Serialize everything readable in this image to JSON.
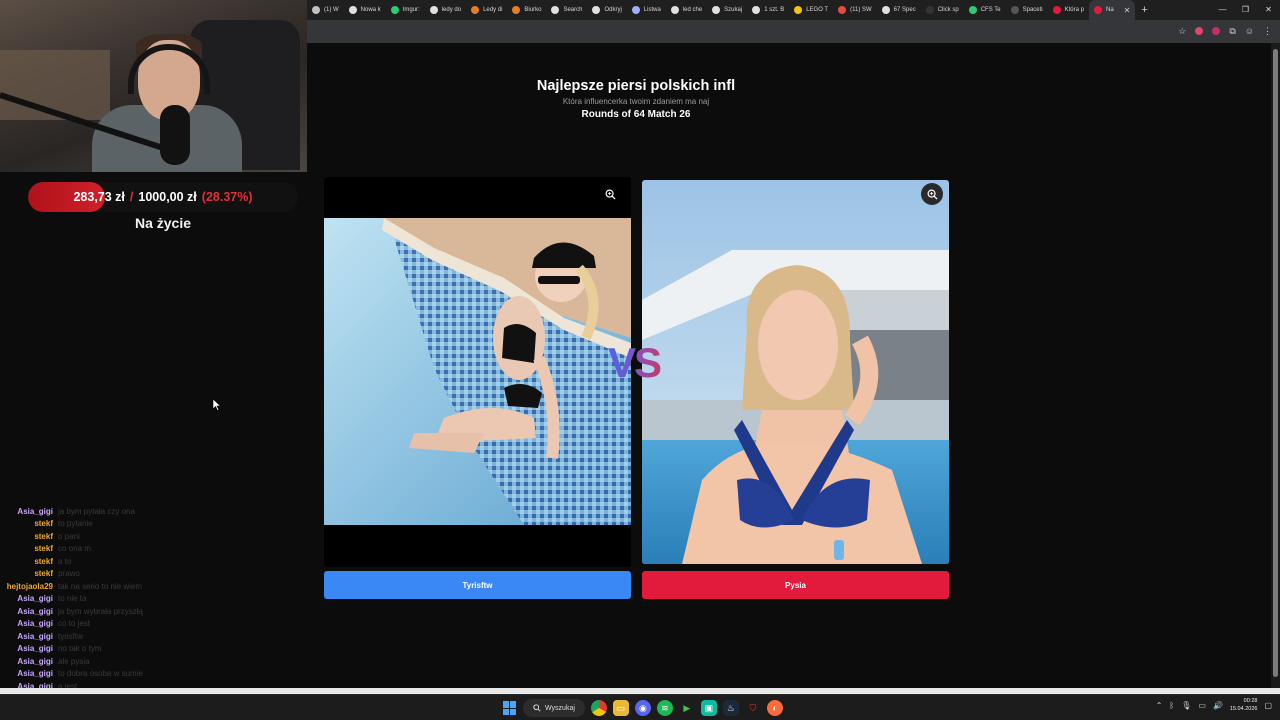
{
  "browser": {
    "tabs": [
      {
        "label": "(1) W",
        "color": "#c0c0c0"
      },
      {
        "label": "Nowa k",
        "color": "#e0e0e0"
      },
      {
        "label": "Imgur:",
        "color": "#2ecc71"
      },
      {
        "label": "ledy do",
        "color": "#e0e0e0"
      },
      {
        "label": "Ledy di",
        "color": "#e67e22"
      },
      {
        "label": "Biurko",
        "color": "#e67e22"
      },
      {
        "label": "Search",
        "color": "#e0e0e0"
      },
      {
        "label": "Odkryj",
        "color": "#e0e0e0"
      },
      {
        "label": "Listwa",
        "color": "#9bb0ff"
      },
      {
        "label": "led che",
        "color": "#e0e0e0"
      },
      {
        "label": "Szukaj",
        "color": "#e0e0e0"
      },
      {
        "label": "1 szt. B",
        "color": "#e0e0e0"
      },
      {
        "label": "LEGO T",
        "color": "#f1c40f"
      },
      {
        "label": "(11) SW",
        "color": "#e74c3c"
      },
      {
        "label": "67 Spec",
        "color": "#e0e0e0"
      },
      {
        "label": "Click sp",
        "color": "#333333"
      },
      {
        "label": "CFS Te",
        "color": "#2ecc71"
      },
      {
        "label": "Spaceti",
        "color": "#555555"
      },
      {
        "label": "Która p",
        "color": "#e21b3c"
      },
      {
        "label": "Na",
        "color": "#e21b3c",
        "active": true
      }
    ],
    "new_tab": "+",
    "window_controls": [
      "—",
      "❐",
      "✕"
    ]
  },
  "stream": {
    "goal": {
      "current": "283,73 zł",
      "separator": "/",
      "target": "1000,00 zł",
      "percent_label": "(28.37%)",
      "progress": 0.2837,
      "label": "Na życie"
    },
    "chat": [
      {
        "user": "Asia_gigi",
        "color": "#c9a6ff",
        "text": "ja bym pytała czy ona"
      },
      {
        "user": "stekf",
        "color": "#f0a830",
        "text": "to pytanie"
      },
      {
        "user": "stekf",
        "color": "#f0a830",
        "text": "o pani"
      },
      {
        "user": "stekf",
        "color": "#f0a830",
        "text": "co ona m"
      },
      {
        "user": "stekf",
        "color": "#f0a830",
        "text": "a to"
      },
      {
        "user": "stekf",
        "color": "#f0a830",
        "text": "prawo"
      },
      {
        "user": "hejtojaola29",
        "color": "#f0a830",
        "text": "tak na serio to nie wiem"
      },
      {
        "user": "Asia_gigi",
        "color": "#c9a6ff",
        "text": "to nie ta"
      },
      {
        "user": "Asia_gigi",
        "color": "#c9a6ff",
        "text": "ja bym wybrała przyszłą"
      },
      {
        "user": "Asia_gigi",
        "color": "#c9a6ff",
        "text": "co to jest"
      },
      {
        "user": "Asia_gigi",
        "color": "#c9a6ff",
        "text": "tyrisftw"
      },
      {
        "user": "Asia_gigi",
        "color": "#c9a6ff",
        "text": "no tak o tym"
      },
      {
        "user": "Asia_gigi",
        "color": "#c9a6ff",
        "text": "ale pysia"
      },
      {
        "user": "Asia_gigi",
        "color": "#c9a6ff",
        "text": "to dobra osoba w sumie"
      },
      {
        "user": "Asia_gigi",
        "color": "#c9a6ff",
        "text": "a jest"
      }
    ],
    "bottom_chat": {
      "user": "hejtojaola29",
      "text": ""
    }
  },
  "page": {
    "title": "Najlepsze piersi polskich infl",
    "subtitle": "Która influencerka twoim zdaniem ma naj",
    "round": "Rounds of 64 Match 26",
    "vs": "VS",
    "left": {
      "name": "Tyrisftw"
    },
    "right": {
      "name": "Pysia"
    }
  },
  "taskbar": {
    "search_label": "Wyszukaj",
    "time": "00:28",
    "date": "15.04.2026"
  }
}
